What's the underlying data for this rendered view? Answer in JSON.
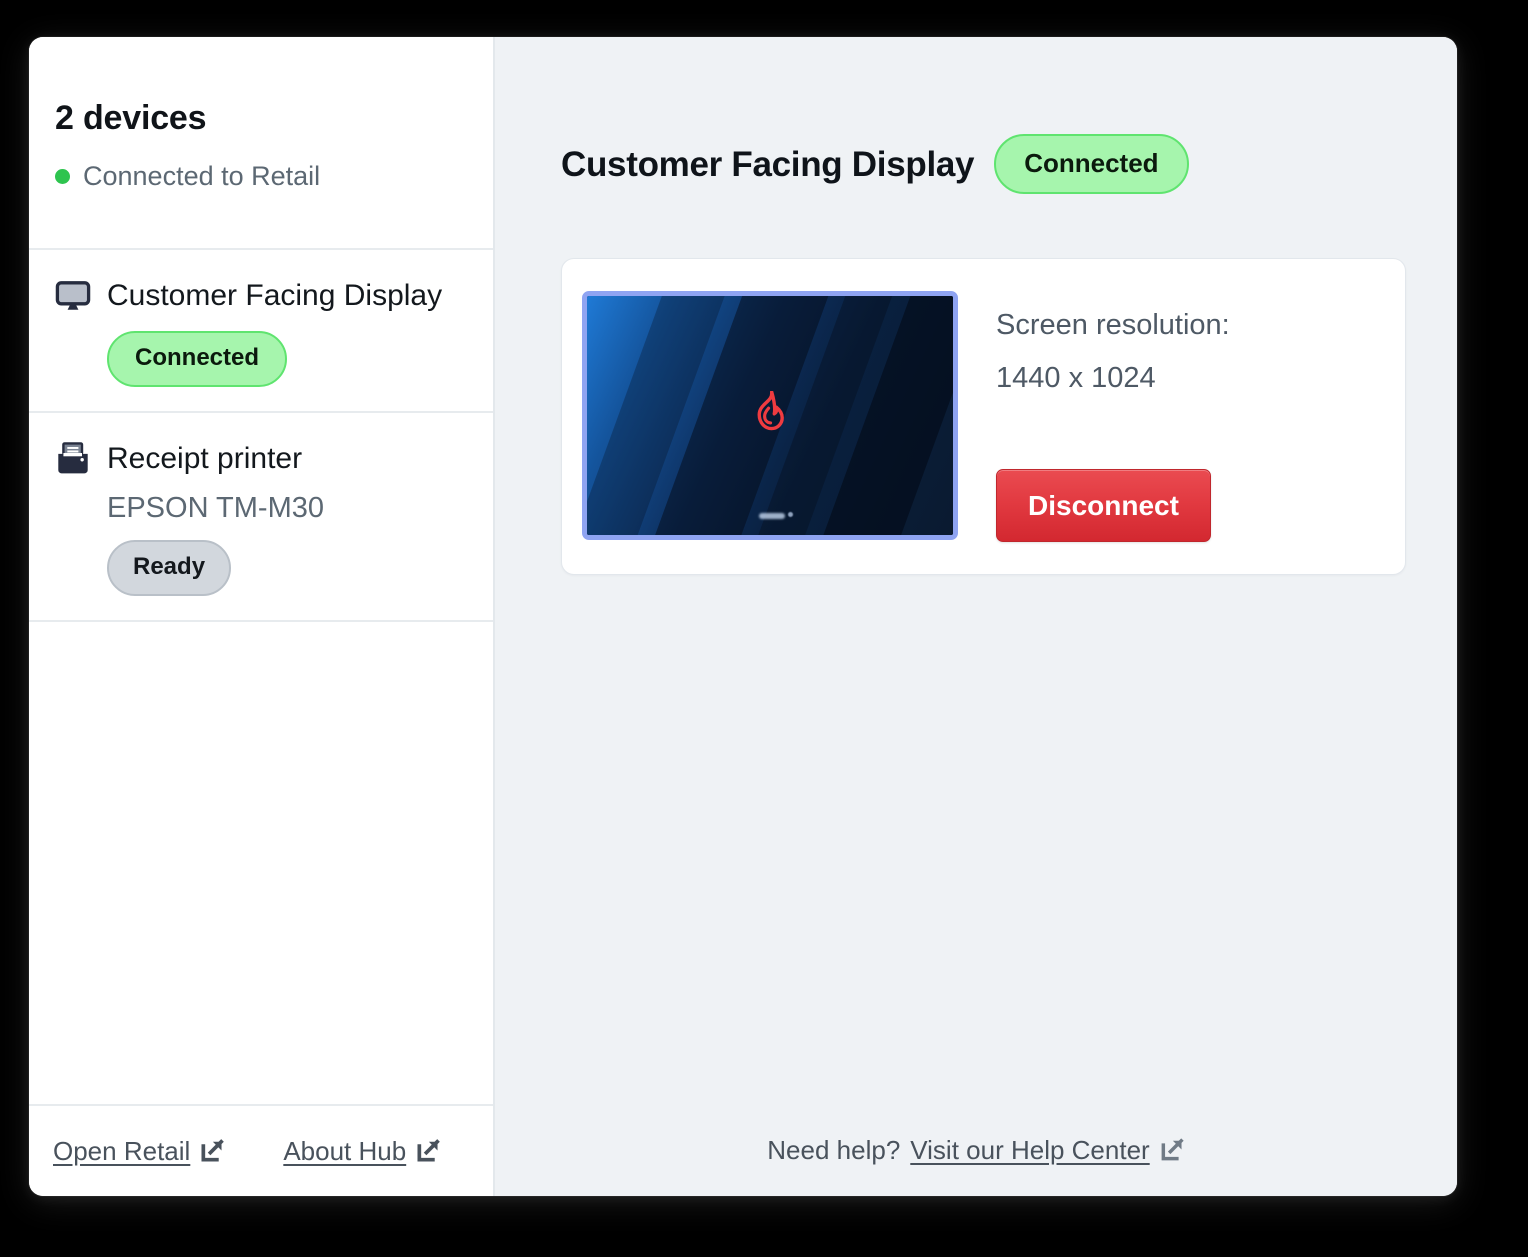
{
  "sidebar": {
    "device_count": "2 devices",
    "connection_status": "Connected to Retail",
    "status_dot_color": "#2ec44f",
    "devices": [
      {
        "icon": "monitor-icon",
        "name": "Customer Facing Display",
        "subtitle": "",
        "badge": "Connected",
        "badge_style": "green"
      },
      {
        "icon": "printer-icon",
        "name": "Receipt printer",
        "subtitle": "EPSON TM-M30",
        "badge": "Ready",
        "badge_style": "gray"
      }
    ],
    "footer_links": [
      {
        "label": "Open Retail",
        "icon": "external-link-icon"
      },
      {
        "label": "About Hub",
        "icon": "external-link-icon"
      }
    ]
  },
  "main": {
    "title": "Customer Facing Display",
    "title_badge": "Connected",
    "detail": {
      "thumbnail_icon": "lightspeed-flame-logo",
      "resolution_label": "Screen resolution:",
      "resolution_value": "1440 x 1024",
      "disconnect_label": "Disconnect"
    },
    "footer": {
      "prefix": "Need help?",
      "link_label": "Visit our Help Center",
      "link_icon": "external-link-icon"
    }
  },
  "colors": {
    "accent_green": "#5fe46f",
    "badge_green_bg": "#a6f5ad",
    "badge_gray_bg": "#d2d7dd",
    "danger_red": "#e23a41",
    "panel_bg": "#eff2f5",
    "thumb_border": "#8fa4f2",
    "text_muted": "#5c6873"
  }
}
